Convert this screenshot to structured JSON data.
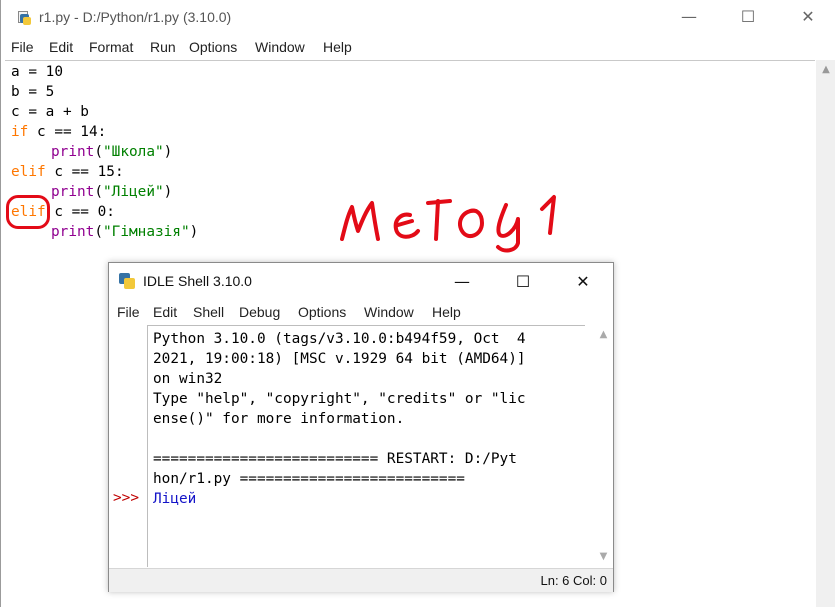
{
  "editor": {
    "title": "r1.py - D:/Python/r1.py (3.10.0)",
    "controls": {
      "minimize": "—",
      "maximize": "☐",
      "close": "✕"
    },
    "menu": [
      "File",
      "Edit",
      "Format",
      "Run",
      "Options",
      "Window",
      "Help"
    ],
    "code": {
      "l1": "a = 10",
      "l2": "b = 5",
      "l3": "c = a + b",
      "l4_kw": "if",
      "l4_rest": " c == 14:",
      "l5_fn": "print",
      "l5_open": "(",
      "l5_str": "\"Школа\"",
      "l5_close": ")",
      "l6_kw": "elif",
      "l6_rest": " c == 15:",
      "l7_fn": "print",
      "l7_open": "(",
      "l7_str": "\"Ліцей\"",
      "l7_close": ")",
      "l8_kw": "elif",
      "l8_rest": " c == 0:",
      "l9_fn": "print",
      "l9_open": "(",
      "l9_str": "\"Гімназія\"",
      "l9_close": ")"
    },
    "annotation": "метод 1"
  },
  "shell": {
    "title": "IDLE Shell 3.10.0",
    "controls": {
      "minimize": "—",
      "maximize": "☐",
      "close": "✕"
    },
    "menu": [
      "File",
      "Edit",
      "Shell",
      "Debug",
      "Options",
      "Window",
      "Help"
    ],
    "prompt": ">>>",
    "lines": [
      "Python 3.10.0 (tags/v3.10.0:b494f59, Oct  4",
      "2021, 19:00:18) [MSC v.1929 64 bit (AMD64)]",
      "on win32",
      "Type \"help\", \"copyright\", \"credits\" or \"lic",
      "ense()\" for more information.",
      "",
      "========================== RESTART: D:/Pyt",
      "hon/r1.py =========================="
    ],
    "output": "Ліцей",
    "status": "Ln: 6   Col: 0"
  },
  "colors": {
    "keyword": "#ff7700",
    "builtin": "#900090",
    "string": "#008000",
    "prompt": "#c00000",
    "output": "#1414c8",
    "annotation": "#e30b17"
  }
}
